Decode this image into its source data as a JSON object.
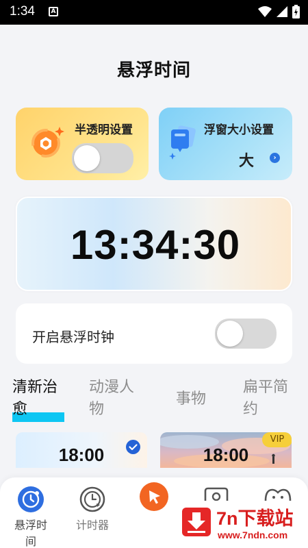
{
  "status_bar": {
    "time": "1:34",
    "notification_icon": "A",
    "icons": [
      "wifi-icon",
      "signal-icon",
      "battery-charging-icon"
    ]
  },
  "page": {
    "title": "悬浮时间"
  },
  "cards": {
    "opacity": {
      "label": "半透明设置",
      "icon": "opacity-ring-icon",
      "enabled": false,
      "color": "#ffd36b"
    },
    "size": {
      "label": "浮窗大小设置",
      "value": "大",
      "icon": "window-size-icon",
      "color": "#7fd0f7"
    }
  },
  "clock": {
    "time": "13:34:30"
  },
  "floating_clock": {
    "label": "开启悬浮时钟",
    "enabled": false
  },
  "theme_tabs": [
    {
      "label": "清新治愈",
      "active": true
    },
    {
      "label": "动漫人物",
      "active": false
    },
    {
      "label": "事物",
      "active": false
    },
    {
      "label": "扁平简约",
      "active": false
    }
  ],
  "themes": [
    {
      "time": "18:00",
      "selected": true
    },
    {
      "time": "18:00",
      "badge": "VIP"
    }
  ],
  "bottom_nav": [
    {
      "label": "悬浮时间",
      "icon": "floating-clock-icon",
      "active": true
    },
    {
      "label": "计时器",
      "icon": "timer-icon",
      "active": false
    },
    {
      "label": "",
      "icon": "tap-pointer-icon",
      "active": false
    },
    {
      "label": "",
      "icon": "photo-frame-icon",
      "active": false
    },
    {
      "label": "",
      "icon": "face-icon",
      "active": false
    }
  ],
  "watermark": {
    "title": "7n下载站",
    "url": "www.7ndn.com"
  },
  "colors": {
    "accent": "#2e6ee0",
    "tab_underline": "#0dc6f3",
    "nav_orange": "#f26522",
    "vip": "#f6cf3a"
  }
}
